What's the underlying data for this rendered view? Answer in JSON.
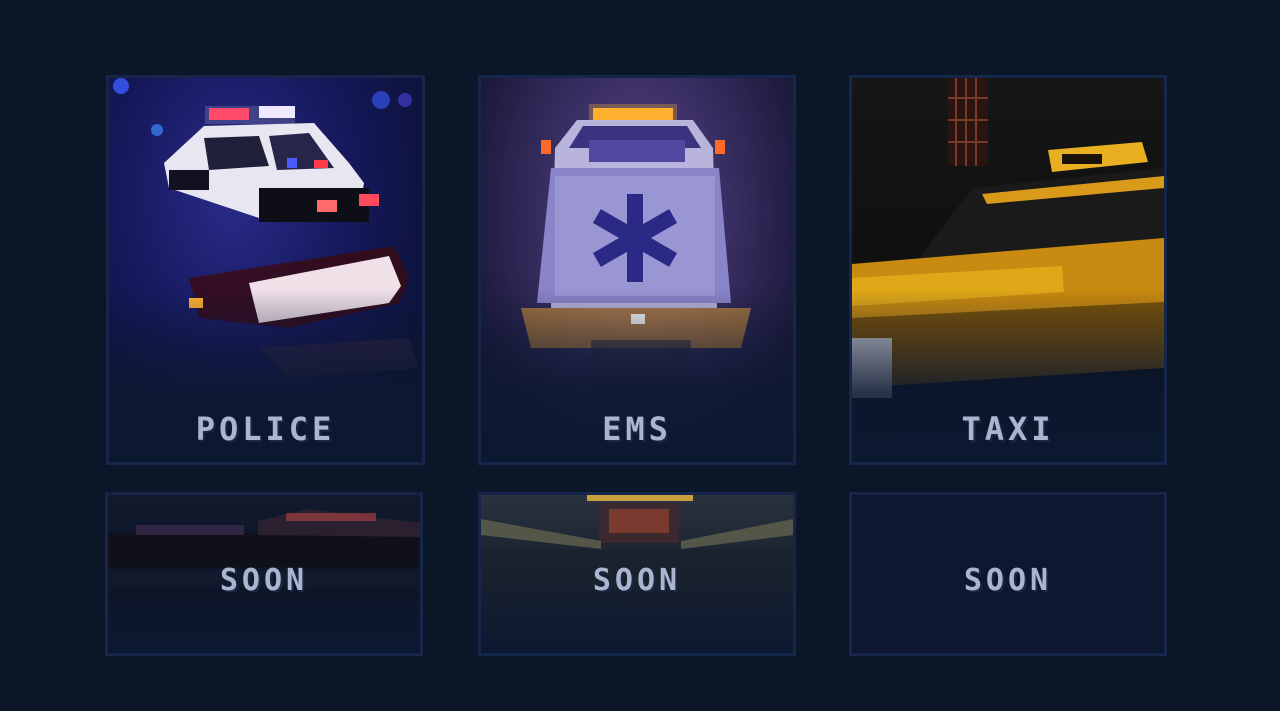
{
  "cards": [
    {
      "id": "police",
      "label": "POLICE"
    },
    {
      "id": "ems",
      "label": "EMS"
    },
    {
      "id": "taxi",
      "label": "TAXI"
    }
  ],
  "soon": [
    {
      "label": "SOON"
    },
    {
      "label": "SOON"
    },
    {
      "label": "SOON"
    }
  ],
  "colors": {
    "background": "#0b1628",
    "card_border": "#15264a",
    "label_text": "#aab6cf",
    "police_light_red": "#ff3b4f",
    "police_light_blue": "#4a5cff",
    "ems_amber": "#ffb030",
    "taxi_yellow": "#e0a010"
  },
  "icons": {
    "police": "police-car-image",
    "ems": "ambulance-image",
    "taxi": "taxi-image"
  }
}
